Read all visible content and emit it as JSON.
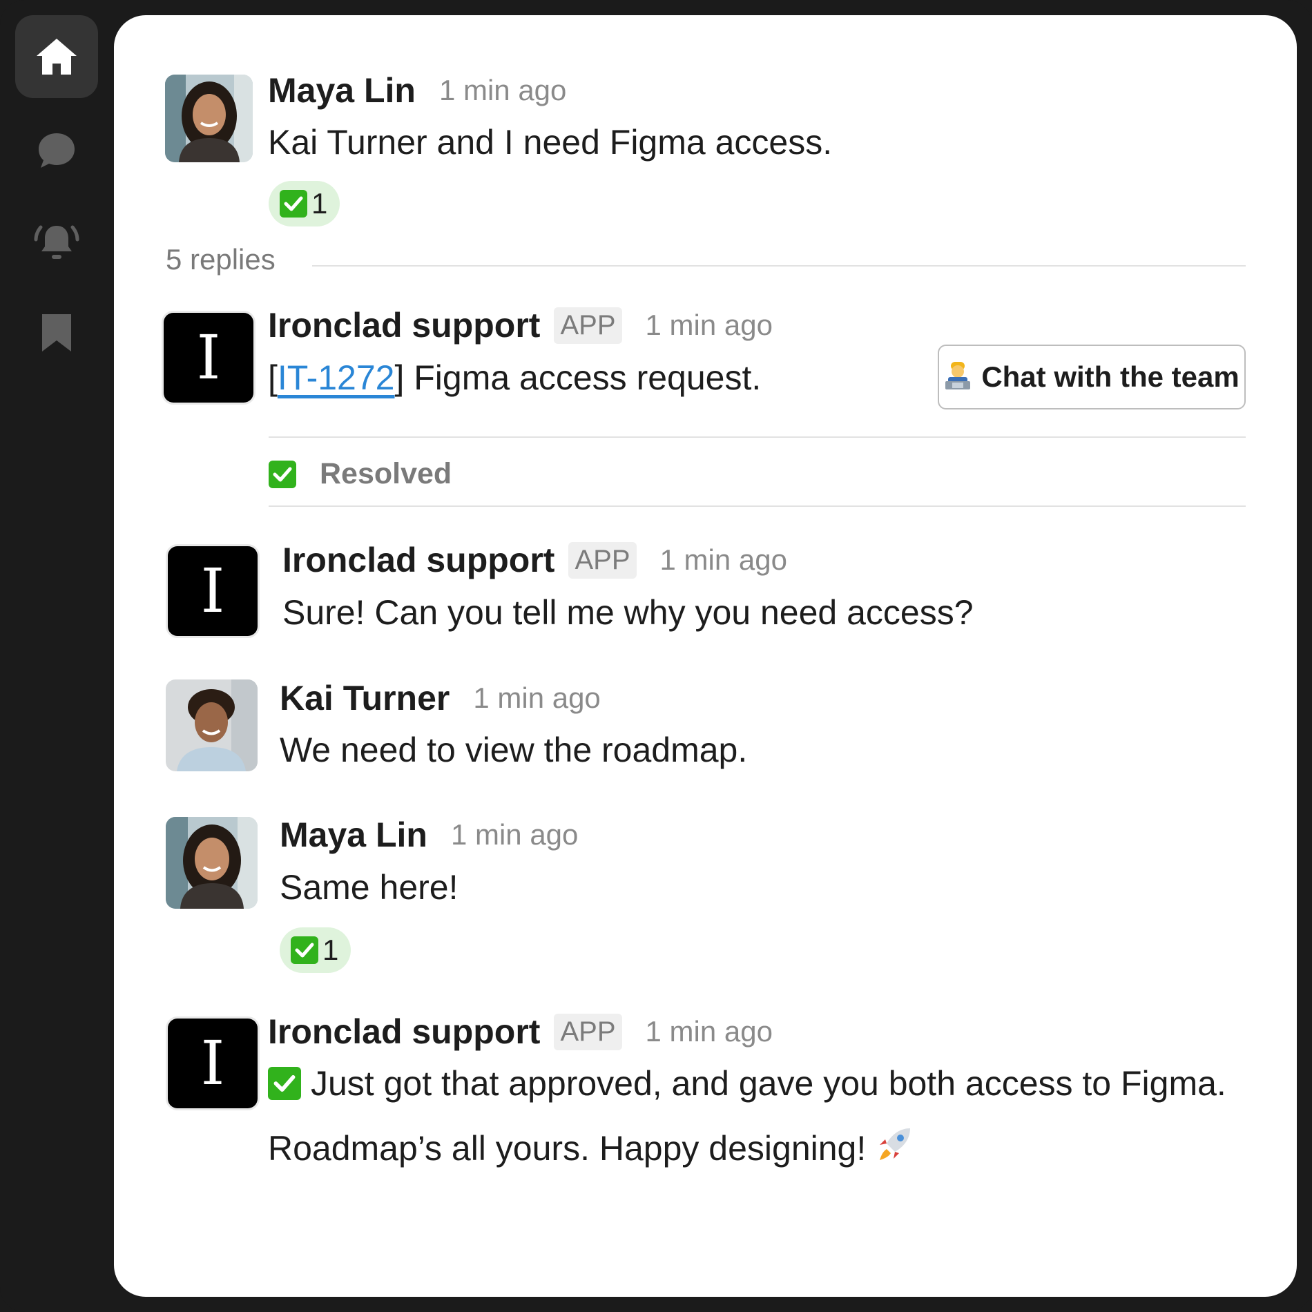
{
  "sidebar": {
    "items": [
      {
        "icon": "home-icon",
        "active": true
      },
      {
        "icon": "chat-bubble-icon",
        "active": false
      },
      {
        "icon": "bell-icon",
        "active": false
      },
      {
        "icon": "bookmark-icon",
        "active": false
      }
    ]
  },
  "thread": {
    "parent": {
      "author": "Maya Lin",
      "time": "1 min ago",
      "text": "Kai Turner and I need Figma access.",
      "reaction": {
        "emoji": "white-check-mark",
        "count": "1"
      }
    },
    "replies_label": "5 replies",
    "messages": [
      {
        "author": "Ironclad support",
        "tag": "APP",
        "time": "1 min ago",
        "avatar_letter": "I",
        "text_open": "[",
        "link": "IT-1272",
        "text_close": "] Figma access request.",
        "button_label": "Chat with the team",
        "button_icon": "technologist-emoji",
        "status_label": "Resolved"
      },
      {
        "author": "Ironclad support",
        "tag": "APP",
        "time": "1 min ago",
        "avatar_letter": "I",
        "text": "Sure! Can you tell me why you need access?"
      },
      {
        "author": "Kai Turner",
        "time": "1 min ago",
        "text": "We need to view the roadmap."
      },
      {
        "author": "Maya Lin",
        "time": "1 min ago",
        "text": "Same here!",
        "reaction": {
          "emoji": "white-check-mark",
          "count": "1"
        }
      },
      {
        "author": "Ironclad support",
        "tag": "APP",
        "time": "1 min ago",
        "avatar_letter": "I",
        "text_line1": "Just got that approved, and gave you both access to Figma.",
        "text_line2": "Roadmap’s all yours. Happy designing!",
        "trailing_icon": "rocket-emoji"
      }
    ]
  },
  "colors": {
    "frame": "#1b1b1b",
    "panel": "#ffffff",
    "link": "#2a86d6",
    "reaction_bg": "#dff3dc",
    "check": "#31b21c"
  }
}
